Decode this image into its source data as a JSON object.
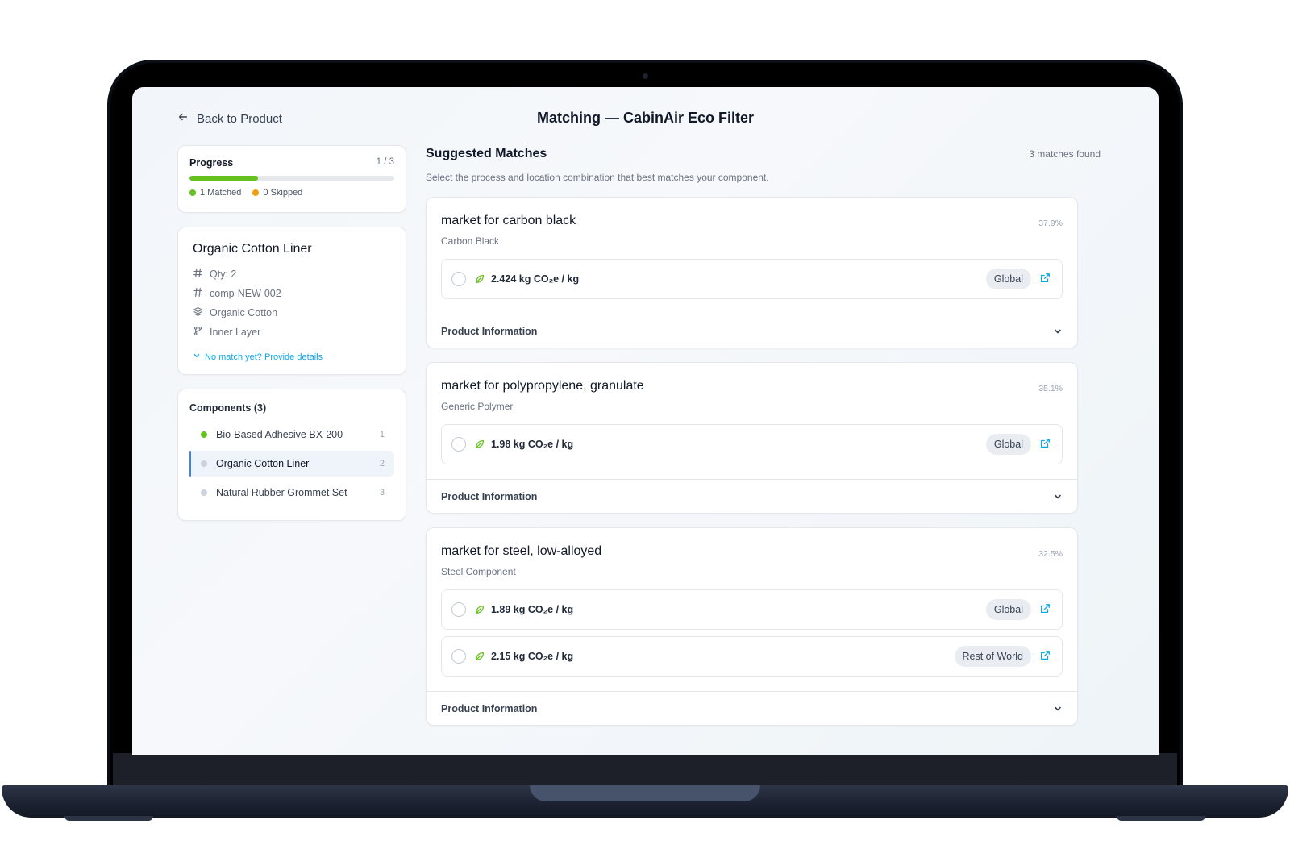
{
  "header": {
    "back_label": "Back to Product",
    "title": "Matching — CabinAir Eco Filter"
  },
  "progress": {
    "label": "Progress",
    "count": "1 / 3",
    "fraction": 0.333,
    "matched_label": "1 Matched",
    "skipped_label": "0 Skipped",
    "matched_color": "#65c11e",
    "skipped_color": "#f59e0b"
  },
  "component": {
    "name": "Organic Cotton Liner",
    "qty": "Qty: 2",
    "id": "comp-NEW-002",
    "material": "Organic Cotton",
    "part": "Inner Layer",
    "provide_label": "No match yet? Provide details"
  },
  "components": {
    "heading": "Components (3)",
    "items": [
      {
        "label": "Bio-Based Adhesive BX-200",
        "num": "1",
        "status_color": "#65c11e"
      },
      {
        "label": "Organic Cotton Liner",
        "num": "2",
        "status_color": "#cbd2dc"
      },
      {
        "label": "Natural Rubber Grommet Set",
        "num": "3",
        "status_color": "#cbd2dc"
      }
    ]
  },
  "matches": {
    "title": "Suggested Matches",
    "count": "3 matches found",
    "subtitle": "Select the process and location combination that best matches your component.",
    "product_info_label": "Product Information",
    "items": [
      {
        "name": "market for carbon black",
        "category": "Carbon Black",
        "score": "37.9%",
        "options": [
          {
            "value": "2.424 kg CO₂e / kg",
            "location": "Global"
          }
        ]
      },
      {
        "name": "market for polypropylene, granulate",
        "category": "Generic Polymer",
        "score": "35.1%",
        "options": [
          {
            "value": "1.98 kg CO₂e / kg",
            "location": "Global"
          }
        ]
      },
      {
        "name": "market for steel, low-alloyed",
        "category": "Steel Component",
        "score": "32.5%",
        "options": [
          {
            "value": "1.89 kg CO₂e / kg",
            "location": "Global"
          },
          {
            "value": "2.15 kg CO₂e / kg",
            "location": "Rest of World"
          }
        ]
      }
    ]
  },
  "colors": {
    "accent": "#0ea5e9",
    "leaf": "#65c11e",
    "active_border": "#3b82f6"
  },
  "icons": {
    "back": "arrow-left-icon",
    "qty": "hash-icon",
    "id": "hash-icon",
    "material": "layers-icon",
    "part": "branch-icon",
    "provide": "chevron-down-icon",
    "leaf": "leaf-icon",
    "external": "external-link-icon",
    "expand": "chevron-down-icon"
  }
}
